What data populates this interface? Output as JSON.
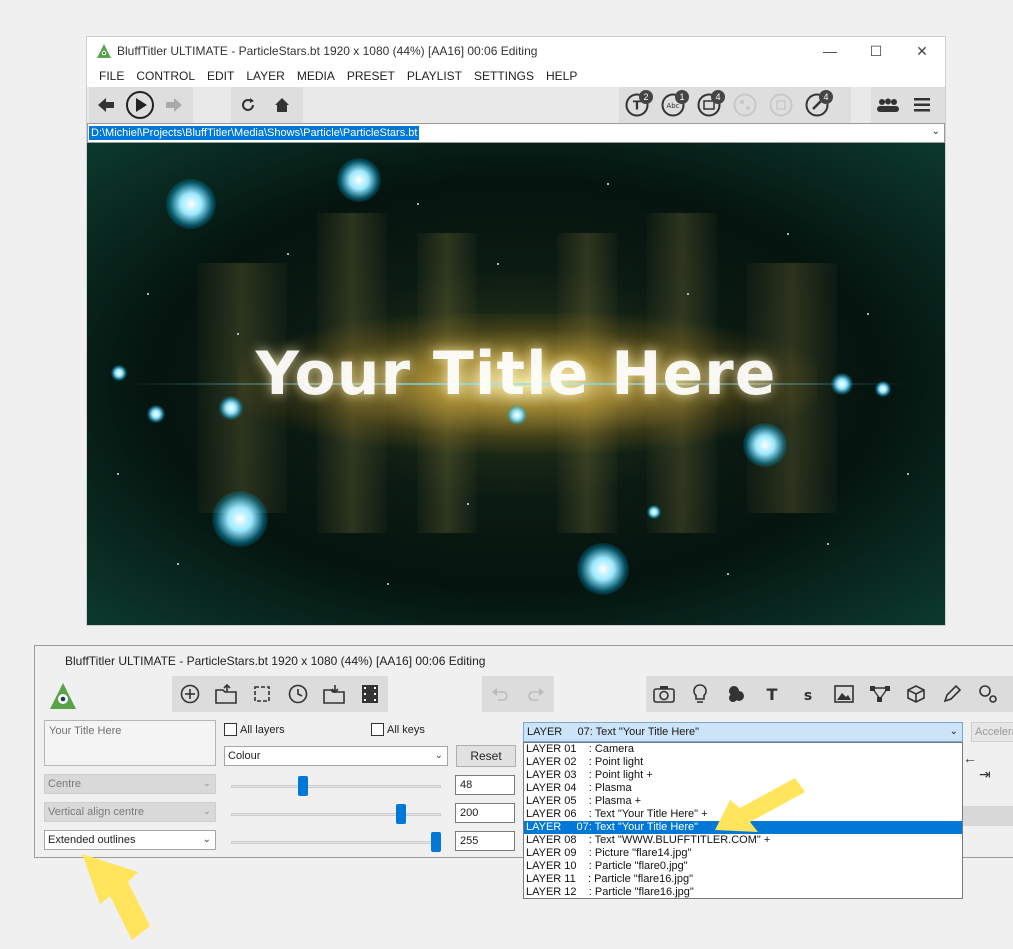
{
  "main_window": {
    "title": "BluffTitler ULTIMATE  - ParticleStars.bt 1920 x 1080 (44%) [AA16] 00:06 Editing",
    "menu": [
      "FILE",
      "CONTROL",
      "EDIT",
      "LAYER",
      "MEDIA",
      "PRESET",
      "PLAYLIST",
      "SETTINGS",
      "HELP"
    ],
    "badges": {
      "text": "2",
      "abc": "1",
      "picture": "4",
      "tool": "4"
    },
    "path": "D:\\Michiel\\Projects\\BluffTitler\\Media\\Shows\\Particle\\ParticleStars.bt",
    "preview_text": "Your Title Here"
  },
  "panel": {
    "title": "BluffTitler ULTIMATE  - ParticleStars.bt 1920 x 1080 (44%) [AA16] 00:06 Editing",
    "text_content": "Your Title Here",
    "all_layers_label": "All layers",
    "all_keys_label": "All keys",
    "property_select": "Colour",
    "reset_label": "Reset",
    "align_select": "Centre",
    "valign_select": "Vertical align centre",
    "style_select": "Extended outlines",
    "values": {
      "v1": "48",
      "v2": "200",
      "v3": "255"
    },
    "sliders": {
      "s1": 48,
      "s2": 200,
      "s3": 255,
      "max": 255
    },
    "layer_selected": "LAYER     07: Text \"Your Title Here\"",
    "accel_label": "Accelera",
    "layers": [
      "LAYER 01    : Camera",
      "LAYER 02    : Point light",
      "LAYER 03    : Point light +",
      "LAYER 04    : Plasma",
      "LAYER 05    : Plasma +",
      "LAYER 06    : Text \"Your Title Here\" +",
      "LAYER     07: Text \"Your Title Here\"",
      "LAYER 08    : Text \"WWW.BLUFFTITLER.COM\" +",
      "LAYER 09    : Picture \"flare14.jpg\"",
      "LAYER 10    : Particle \"flare0.jpg\"",
      "LAYER 11    : Particle \"flare16.jpg\"",
      "LAYER 12    : Particle \"flare16.jpg\""
    ],
    "selected_layer_index": 6
  },
  "colors": {
    "accent": "#0078d7",
    "arrow": "#ffe45c"
  }
}
